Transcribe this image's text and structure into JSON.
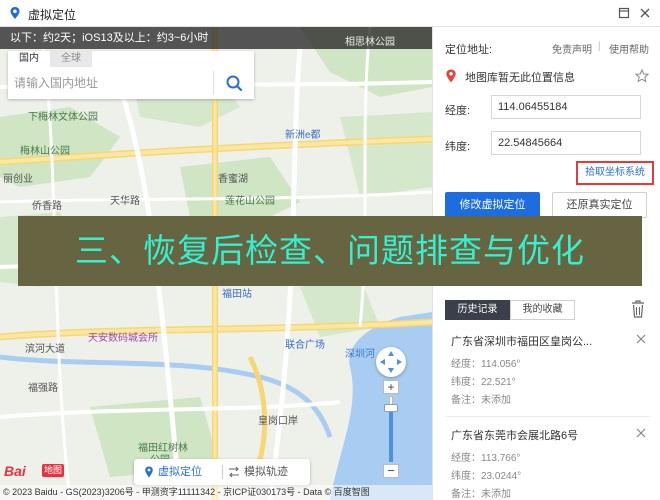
{
  "window": {
    "title": "虚拟定位",
    "icon": "map-pin-icon",
    "minimize_icon": "restore-icon",
    "close_icon": "close-icon"
  },
  "map": {
    "notice": "以下：约2天；iOS13及以上：约3~6小时",
    "search": {
      "tab_domestic": "国内",
      "tab_global": "全球",
      "placeholder": "请输入国内地址",
      "button_icon": "search-icon"
    },
    "labels": {
      "park_top": "相思林公园",
      "xiamei_park": "下梅林文体公园",
      "meilin_park": "梅林山公园",
      "xinzhou": "新洲e都",
      "xiangmihu": "香蜜湖",
      "tianhua": "天华路",
      "lianhuashan": "莲花山公园",
      "qiaoxiang": "侨香路",
      "lichuang": "丽创业",
      "futian_station": "福田站",
      "tianan": "天安数码城会所",
      "lianhe": "联合广场",
      "binhe": "滨河大道",
      "fuqiang": "福强路",
      "shennan": "深圳河",
      "bolan": "皇岗口岸",
      "hongshu": "福田红树林",
      "hongshu_park": "公园"
    },
    "zoom_plus": "+",
    "zoom_minus": "−",
    "compass_icon": "compass-icon",
    "logo": {
      "text": "Bai",
      "sub": "地图"
    },
    "copyright": "© 2023 Baidu - GS(2023)3206号 - 甲测资字11111342 - 京ICP证030173号 - Data © 百度智图",
    "mode_bar": {
      "virtual": "虚拟定位",
      "track": "模拟轨迹",
      "virtual_icon": "location-pin-icon",
      "track_icon": "route-icon"
    }
  },
  "panel": {
    "location_label": "定位地址:",
    "disclaimer_link": "免责声明",
    "separator": "|",
    "help_link": "使用帮助",
    "location_text": "地图库暂无此位置信息",
    "location_icon": "location-pin-icon",
    "favorite_icon": "star-icon",
    "longitude_label": "经度:",
    "longitude_value": "114.06455184",
    "latitude_label": "纬度:",
    "latitude_value": "22.54845664",
    "pick_button": "拾取坐标系统",
    "modify_button": "修改虚拟定位",
    "restore_button": "还原真实定位",
    "history_tab": "历史记录",
    "favorites_tab": "我的收藏",
    "trash_icon": "trash-icon",
    "history": [
      {
        "title": "广东省深圳市福田区皇岗公...",
        "lng": "经度：114.056°",
        "lat": "纬度：22.521°",
        "note": "备注：未添加"
      },
      {
        "title": "广东省东莞市会展北路6号",
        "lng": "经度：113.766°",
        "lat": "纬度：23.0244°",
        "note": "备注：未添加"
      }
    ]
  },
  "banner": {
    "text": "三、恢复后检查、问题排查与优化"
  },
  "colors": {
    "accent": "#1e6de0",
    "highlight": "#e33b3b",
    "banner_bg": "#676541",
    "banner_text": "#35f0cf"
  }
}
